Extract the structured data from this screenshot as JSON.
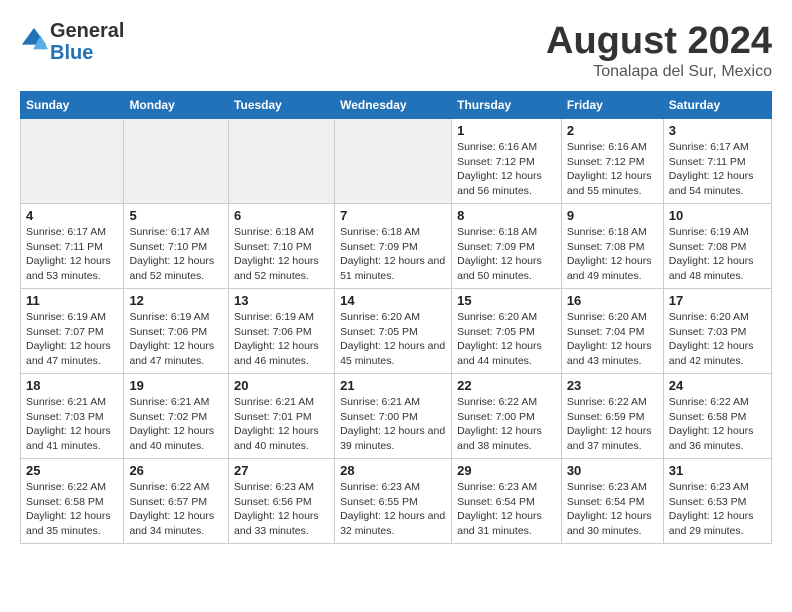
{
  "header": {
    "logo_line1": "General",
    "logo_line2": "Blue",
    "month_year": "August 2024",
    "location": "Tonalapa del Sur, Mexico"
  },
  "weekdays": [
    "Sunday",
    "Monday",
    "Tuesday",
    "Wednesday",
    "Thursday",
    "Friday",
    "Saturday"
  ],
  "weeks": [
    [
      {
        "day": "",
        "empty": true
      },
      {
        "day": "",
        "empty": true
      },
      {
        "day": "",
        "empty": true
      },
      {
        "day": "",
        "empty": true
      },
      {
        "day": "1",
        "sunrise": "6:16 AM",
        "sunset": "7:12 PM",
        "daylight": "12 hours and 56 minutes."
      },
      {
        "day": "2",
        "sunrise": "6:16 AM",
        "sunset": "7:12 PM",
        "daylight": "12 hours and 55 minutes."
      },
      {
        "day": "3",
        "sunrise": "6:17 AM",
        "sunset": "7:11 PM",
        "daylight": "12 hours and 54 minutes."
      }
    ],
    [
      {
        "day": "4",
        "sunrise": "6:17 AM",
        "sunset": "7:11 PM",
        "daylight": "12 hours and 53 minutes."
      },
      {
        "day": "5",
        "sunrise": "6:17 AM",
        "sunset": "7:10 PM",
        "daylight": "12 hours and 52 minutes."
      },
      {
        "day": "6",
        "sunrise": "6:18 AM",
        "sunset": "7:10 PM",
        "daylight": "12 hours and 52 minutes."
      },
      {
        "day": "7",
        "sunrise": "6:18 AM",
        "sunset": "7:09 PM",
        "daylight": "12 hours and 51 minutes."
      },
      {
        "day": "8",
        "sunrise": "6:18 AM",
        "sunset": "7:09 PM",
        "daylight": "12 hours and 50 minutes."
      },
      {
        "day": "9",
        "sunrise": "6:18 AM",
        "sunset": "7:08 PM",
        "daylight": "12 hours and 49 minutes."
      },
      {
        "day": "10",
        "sunrise": "6:19 AM",
        "sunset": "7:08 PM",
        "daylight": "12 hours and 48 minutes."
      }
    ],
    [
      {
        "day": "11",
        "sunrise": "6:19 AM",
        "sunset": "7:07 PM",
        "daylight": "12 hours and 47 minutes."
      },
      {
        "day": "12",
        "sunrise": "6:19 AM",
        "sunset": "7:06 PM",
        "daylight": "12 hours and 47 minutes."
      },
      {
        "day": "13",
        "sunrise": "6:19 AM",
        "sunset": "7:06 PM",
        "daylight": "12 hours and 46 minutes."
      },
      {
        "day": "14",
        "sunrise": "6:20 AM",
        "sunset": "7:05 PM",
        "daylight": "12 hours and 45 minutes."
      },
      {
        "day": "15",
        "sunrise": "6:20 AM",
        "sunset": "7:05 PM",
        "daylight": "12 hours and 44 minutes."
      },
      {
        "day": "16",
        "sunrise": "6:20 AM",
        "sunset": "7:04 PM",
        "daylight": "12 hours and 43 minutes."
      },
      {
        "day": "17",
        "sunrise": "6:20 AM",
        "sunset": "7:03 PM",
        "daylight": "12 hours and 42 minutes."
      }
    ],
    [
      {
        "day": "18",
        "sunrise": "6:21 AM",
        "sunset": "7:03 PM",
        "daylight": "12 hours and 41 minutes."
      },
      {
        "day": "19",
        "sunrise": "6:21 AM",
        "sunset": "7:02 PM",
        "daylight": "12 hours and 40 minutes."
      },
      {
        "day": "20",
        "sunrise": "6:21 AM",
        "sunset": "7:01 PM",
        "daylight": "12 hours and 40 minutes."
      },
      {
        "day": "21",
        "sunrise": "6:21 AM",
        "sunset": "7:00 PM",
        "daylight": "12 hours and 39 minutes."
      },
      {
        "day": "22",
        "sunrise": "6:22 AM",
        "sunset": "7:00 PM",
        "daylight": "12 hours and 38 minutes."
      },
      {
        "day": "23",
        "sunrise": "6:22 AM",
        "sunset": "6:59 PM",
        "daylight": "12 hours and 37 minutes."
      },
      {
        "day": "24",
        "sunrise": "6:22 AM",
        "sunset": "6:58 PM",
        "daylight": "12 hours and 36 minutes."
      }
    ],
    [
      {
        "day": "25",
        "sunrise": "6:22 AM",
        "sunset": "6:58 PM",
        "daylight": "12 hours and 35 minutes."
      },
      {
        "day": "26",
        "sunrise": "6:22 AM",
        "sunset": "6:57 PM",
        "daylight": "12 hours and 34 minutes."
      },
      {
        "day": "27",
        "sunrise": "6:23 AM",
        "sunset": "6:56 PM",
        "daylight": "12 hours and 33 minutes."
      },
      {
        "day": "28",
        "sunrise": "6:23 AM",
        "sunset": "6:55 PM",
        "daylight": "12 hours and 32 minutes."
      },
      {
        "day": "29",
        "sunrise": "6:23 AM",
        "sunset": "6:54 PM",
        "daylight": "12 hours and 31 minutes."
      },
      {
        "day": "30",
        "sunrise": "6:23 AM",
        "sunset": "6:54 PM",
        "daylight": "12 hours and 30 minutes."
      },
      {
        "day": "31",
        "sunrise": "6:23 AM",
        "sunset": "6:53 PM",
        "daylight": "12 hours and 29 minutes."
      }
    ]
  ],
  "labels": {
    "sunrise": "Sunrise:",
    "sunset": "Sunset:",
    "daylight": "Daylight:"
  }
}
